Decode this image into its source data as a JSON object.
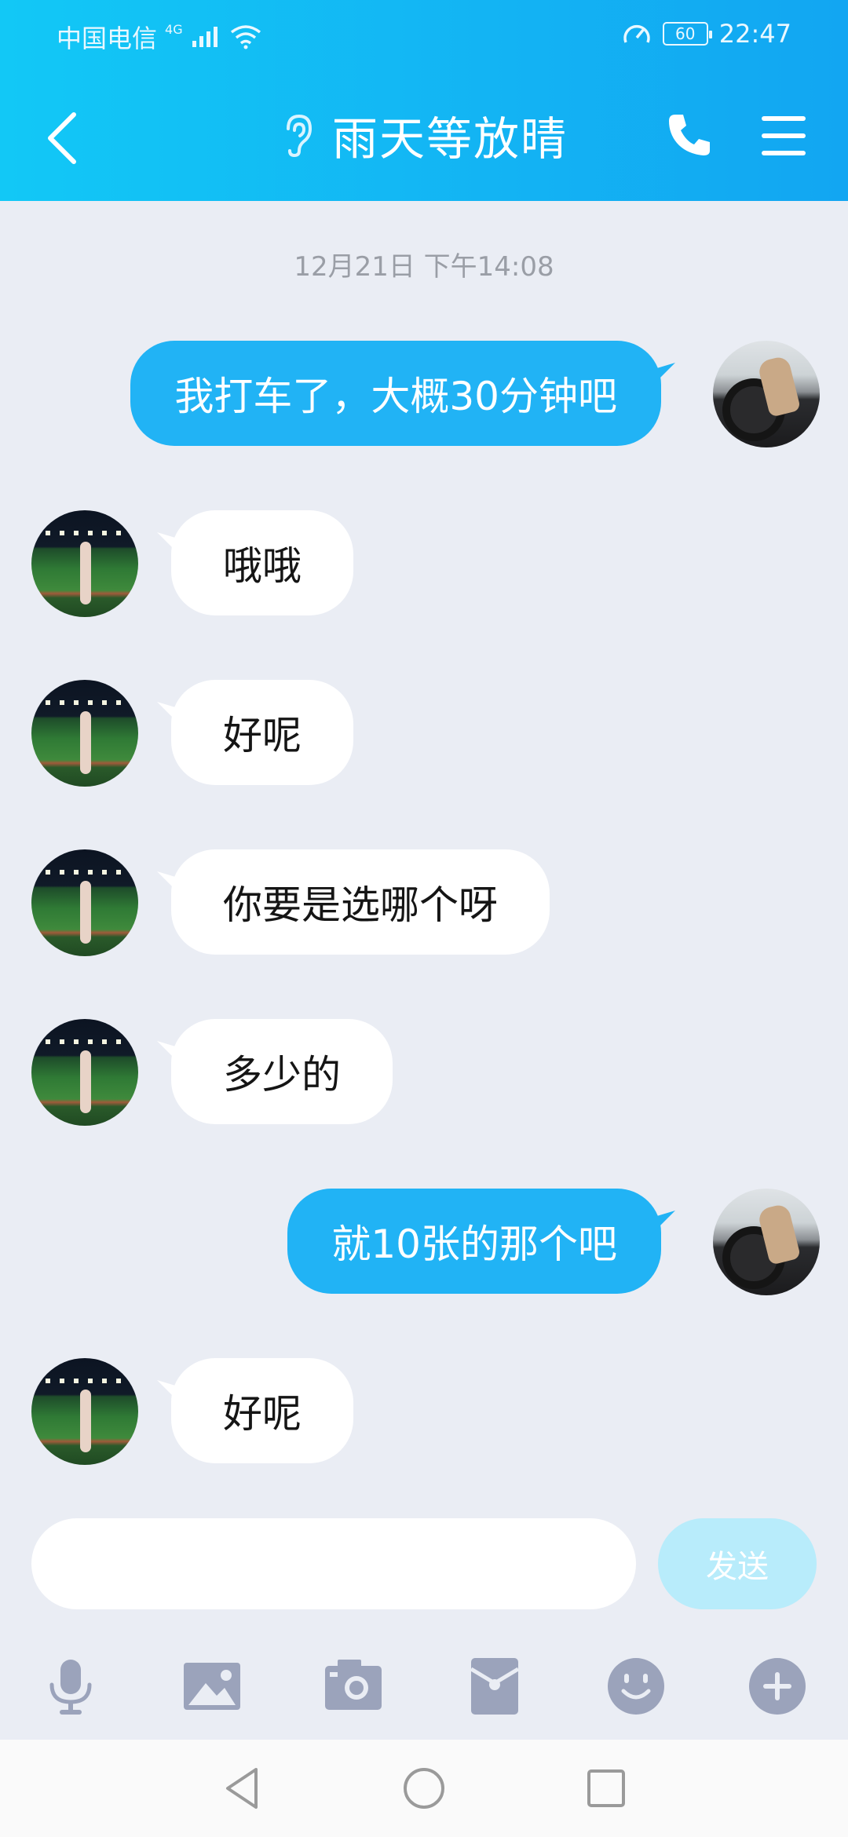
{
  "status_bar": {
    "carrier": "中国电信",
    "network_tag": "4G",
    "battery": "60",
    "time": "22:47"
  },
  "header": {
    "title": "雨天等放晴",
    "icons": [
      "back-icon",
      "ear-icon",
      "phone-icon",
      "menu-icon"
    ]
  },
  "chat": {
    "timestamp": "12月21日 下午14:08",
    "messages": [
      {
        "side": "out",
        "text": "我打车了，大概30分钟吧"
      },
      {
        "side": "in",
        "text": "哦哦"
      },
      {
        "side": "in",
        "text": "好呢"
      },
      {
        "side": "in",
        "text": "你要是选哪个呀"
      },
      {
        "side": "in",
        "text": "多少的"
      },
      {
        "side": "out",
        "text": "就10张的那个吧"
      },
      {
        "side": "in",
        "text": "好呢"
      }
    ]
  },
  "input": {
    "value": "",
    "placeholder": "",
    "send_label": "发送"
  },
  "toolbar": {
    "icons": [
      "microphone-icon",
      "image-icon",
      "camera-icon",
      "red-packet-icon",
      "emoji-icon",
      "plus-icon"
    ]
  },
  "nav": {
    "icons": [
      "back-triangle-icon",
      "home-circle-icon",
      "recent-square-icon"
    ]
  },
  "colors": {
    "header_start": "#12c8f6",
    "header_end": "#12a6f2",
    "outgoing_bubble": "#21b3f5",
    "incoming_bubble": "#ffffff",
    "chat_background": "#eaedf4",
    "toolbar_icon": "#9ba3bb",
    "send_button": "#b8ecfb"
  }
}
